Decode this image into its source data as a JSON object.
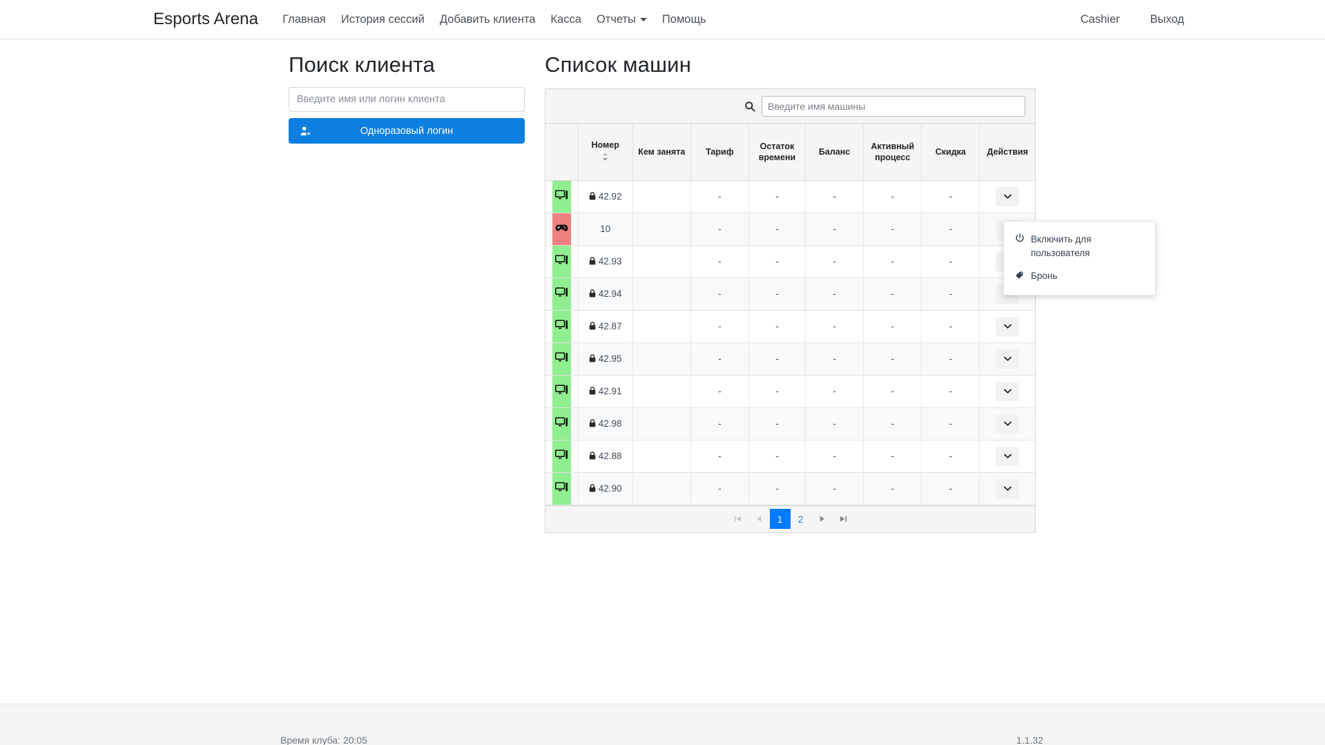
{
  "navbar": {
    "brand": "Esports Arena",
    "links": [
      {
        "label": "Главная",
        "name": "nav-home"
      },
      {
        "label": "История сессий",
        "name": "nav-session-history"
      },
      {
        "label": "Добавить клиента",
        "name": "nav-add-client"
      },
      {
        "label": "Касса",
        "name": "nav-cashbox"
      },
      {
        "label": "Отчеты",
        "name": "nav-reports",
        "dropdown": true
      },
      {
        "label": "Помощь",
        "name": "nav-help"
      }
    ],
    "user": "Cashier",
    "logout": "Выход"
  },
  "client_search": {
    "title": "Поиск клиента",
    "input_placeholder": "Введите имя или логин клиента",
    "input_value": "",
    "button_label": "Одноразовый логин"
  },
  "machines": {
    "title": "Список машин",
    "search_placeholder": "Введите имя машины",
    "search_value": "",
    "columns": [
      {
        "label": "",
        "key": "status"
      },
      {
        "label": "Номер",
        "key": "number",
        "sortable": true
      },
      {
        "label": "Кем занята",
        "key": "occupied_by"
      },
      {
        "label": "Тариф",
        "key": "tariff"
      },
      {
        "label": "Остаток времени",
        "key": "time_left"
      },
      {
        "label": "Баланс",
        "key": "balance"
      },
      {
        "label": "Активный процесс",
        "key": "active_process"
      },
      {
        "label": "Скидка",
        "key": "discount"
      },
      {
        "label": "Действия",
        "key": "actions"
      }
    ],
    "rows": [
      {
        "status": "free",
        "icon": "monitor-icon",
        "locked": true,
        "number": "42.92",
        "occupied_by": "",
        "tariff": "-",
        "time_left": "-",
        "balance": "-",
        "active_process": "-",
        "discount": "-"
      },
      {
        "status": "busy",
        "icon": "gamepad-icon",
        "locked": false,
        "number": "10",
        "occupied_by": "",
        "tariff": "-",
        "time_left": "-",
        "balance": "-",
        "active_process": "-",
        "discount": "-"
      },
      {
        "status": "free",
        "icon": "monitor-icon",
        "locked": true,
        "number": "42.93",
        "occupied_by": "",
        "tariff": "-",
        "time_left": "-",
        "balance": "-",
        "active_process": "-",
        "discount": "-"
      },
      {
        "status": "free",
        "icon": "monitor-icon",
        "locked": true,
        "number": "42.94",
        "occupied_by": "",
        "tariff": "-",
        "time_left": "-",
        "balance": "-",
        "active_process": "-",
        "discount": "-"
      },
      {
        "status": "free",
        "icon": "monitor-icon",
        "locked": true,
        "number": "42.87",
        "occupied_by": "",
        "tariff": "-",
        "time_left": "-",
        "balance": "-",
        "active_process": "-",
        "discount": "-"
      },
      {
        "status": "free",
        "icon": "monitor-icon",
        "locked": true,
        "number": "42.95",
        "occupied_by": "",
        "tariff": "-",
        "time_left": "-",
        "balance": "-",
        "active_process": "-",
        "discount": "-"
      },
      {
        "status": "free",
        "icon": "monitor-icon",
        "locked": true,
        "number": "42.91",
        "occupied_by": "",
        "tariff": "-",
        "time_left": "-",
        "balance": "-",
        "active_process": "-",
        "discount": "-"
      },
      {
        "status": "free",
        "icon": "monitor-icon",
        "locked": true,
        "number": "42.98",
        "occupied_by": "",
        "tariff": "-",
        "time_left": "-",
        "balance": "-",
        "active_process": "-",
        "discount": "-"
      },
      {
        "status": "free",
        "icon": "monitor-icon",
        "locked": true,
        "number": "42.88",
        "occupied_by": "",
        "tariff": "-",
        "time_left": "-",
        "balance": "-",
        "active_process": "-",
        "discount": "-"
      },
      {
        "status": "free",
        "icon": "monitor-icon",
        "locked": true,
        "number": "42.90",
        "occupied_by": "",
        "tariff": "-",
        "time_left": "-",
        "balance": "-",
        "active_process": "-",
        "discount": "-"
      }
    ],
    "pagination": {
      "first": "⏮",
      "prev": "◀",
      "next": "▶",
      "last": "⏭",
      "pages": [
        "1",
        "2"
      ],
      "active": "1"
    }
  },
  "context_menu": {
    "open_for_row_index": 1,
    "items": [
      {
        "label": "Включить для пользователя",
        "icon": "power-icon"
      },
      {
        "label": "Бронь",
        "icon": "tag-icon"
      }
    ]
  },
  "footer": {
    "club_time": "Время клуба: 20:05",
    "version": "1.1.32"
  },
  "colors": {
    "status_free": "#90ee90",
    "status_busy": "#f08080",
    "primary": "#0d7fe0",
    "pager_active": "#007bff"
  }
}
